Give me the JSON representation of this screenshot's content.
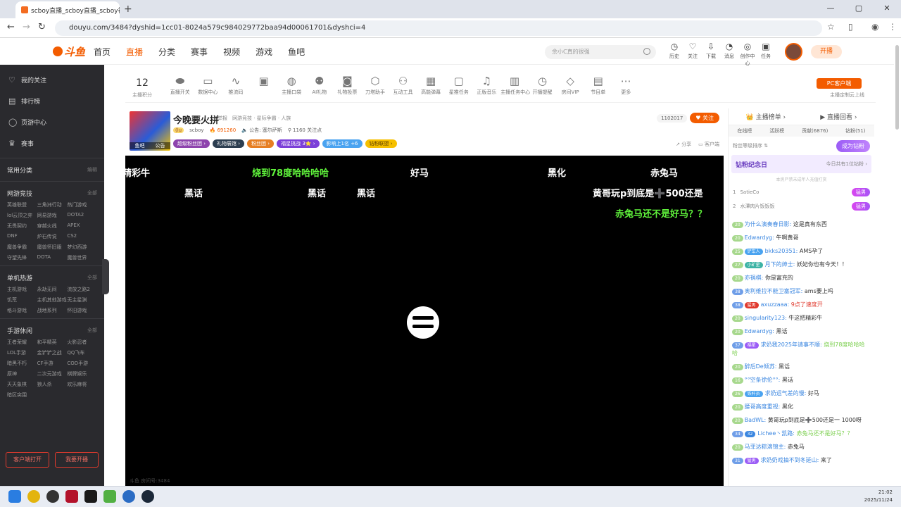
{
  "browser": {
    "tab_title": "scboy直播_scboy直播_scboy视",
    "tab_close": "✕",
    "new_tab": "+",
    "url": "douyu.com/3484?dyshid=1cc01-8024a579c984029772baa94d00061701&dyshci=4",
    "window_controls": [
      "—",
      "▢",
      "✕"
    ]
  },
  "topnav": {
    "logo": "斗鱼",
    "menu": [
      "首页",
      "直播",
      "分类",
      "赛事",
      "视频",
      "游戏",
      "鱼吧"
    ],
    "active_menu": "直播",
    "search_placeholder": "余小C真的很强",
    "tools": [
      {
        "icon": "history-icon",
        "glyph": "◷",
        "label": "历史"
      },
      {
        "icon": "heart-icon",
        "glyph": "♡",
        "label": "关注"
      },
      {
        "icon": "download-icon",
        "glyph": "⇩",
        "label": "下载"
      },
      {
        "icon": "bell-icon",
        "glyph": "◔",
        "label": "消息"
      },
      {
        "icon": "bulb-icon",
        "glyph": "◎",
        "label": "创作中心"
      },
      {
        "icon": "gift-icon",
        "glyph": "▣",
        "label": "任务"
      }
    ],
    "live_button": "开播"
  },
  "sidebar": {
    "top": [
      {
        "glyph": "♡",
        "label": "我的关注"
      },
      {
        "glyph": "▤",
        "label": "排行榜"
      },
      {
        "glyph": "◯",
        "label": "页游中心"
      },
      {
        "glyph": "♛",
        "label": "赛事"
      }
    ],
    "common": {
      "title": "常用分类",
      "more": "编辑"
    },
    "sections": [
      {
        "title": "网游竞技",
        "more": "全部",
        "items": [
          "英雄联盟",
          "三角洲行动",
          "热门游戏",
          "lol云顶之弈",
          "网易游戏",
          "DOTA2",
          "无畏契约",
          "穿越火线",
          "APEX",
          "DNF",
          "炉石传说",
          "CS2",
          "魔兽争霸",
          "魔兽怀旧服",
          "梦幻西游",
          "守望先锋",
          "DOTA",
          "魔兽世界"
        ]
      },
      {
        "title": "单机热游",
        "more": "全部",
        "items": [
          "主机游戏",
          "永劫无间",
          "流放之路2",
          "饥荒",
          "主机其他游戏",
          "无主星渊",
          "格斗游戏",
          "战地系列",
          "怀旧游戏"
        ]
      },
      {
        "title": "手游休闲",
        "more": "全部",
        "items": [
          "王者荣耀",
          "和平精英",
          "火影忍者",
          "LOL手游",
          "金铲铲之战",
          "QQ飞车",
          "暗黑不朽",
          "CF手游",
          "COD手游",
          "原神",
          "二次元游戏",
          "棋牌娱乐",
          "天天象棋",
          "狼人杀",
          "欢乐麻将",
          "暗区突围"
        ]
      }
    ],
    "btn_client": "客户端打开",
    "btn_live": "我要开播"
  },
  "toolbar": {
    "level": "12",
    "level_label": "主播积分",
    "items": [
      {
        "icon": "toggle-icon",
        "glyph": "⬬",
        "label": "直播开关"
      },
      {
        "icon": "monitor-icon",
        "glyph": "▭",
        "label": "数据中心"
      },
      {
        "icon": "wave-icon",
        "glyph": "∿",
        "label": "推流码"
      },
      {
        "icon": "gift-box-icon",
        "glyph": "▣",
        "label": " "
      },
      {
        "icon": "bag-icon",
        "glyph": "◍",
        "label": "主播口袋"
      },
      {
        "icon": "ai-icon",
        "glyph": "⚉",
        "label": "AI礼物"
      },
      {
        "icon": "cup-icon",
        "glyph": "◙",
        "label": "礼物投票"
      },
      {
        "icon": "shield-icon",
        "glyph": "⬡",
        "label": "刀塔助手"
      },
      {
        "icon": "people-icon",
        "glyph": "⚇",
        "label": "互动工具"
      },
      {
        "icon": "screen-icon",
        "glyph": "▦",
        "label": "高能弹幕"
      },
      {
        "icon": "ad-icon",
        "glyph": "▢",
        "label": "星推任务"
      },
      {
        "icon": "music-icon",
        "glyph": "♫",
        "label": "正版音乐"
      },
      {
        "icon": "clipboard-icon",
        "glyph": "▥",
        "label": "主播任务中心"
      },
      {
        "icon": "alarm-icon",
        "glyph": "◷",
        "label": "开播提醒"
      },
      {
        "icon": "diamond-icon",
        "glyph": "◇",
        "label": "房间VIP"
      },
      {
        "icon": "doc-icon",
        "glyph": "▤",
        "label": "节目单"
      },
      {
        "icon": "more-icon",
        "glyph": "⋯",
        "label": "更多"
      }
    ],
    "pc_client": "PC客户端",
    "pc_sub": "主播定制云上线"
  },
  "room": {
    "cover_left": "鱼吧",
    "cover_right": "公告",
    "title": "今晚要火拼",
    "tags": "举报　网游竞技 · 星际争霸 · 人族",
    "level": "(lu",
    "streamer": "scboy",
    "heat": "🔥 691260",
    "notice": "🔈 公告: 塞尔萨斯",
    "viewers": "⚲ 1160 关注点",
    "badges": [
      "超级粉丝团 ›",
      "礼物展馆 ›",
      "粉丝团 ›",
      "福星挑战 3⭐ ›",
      "影响上1名 +6",
      "钻粉联盟 ›"
    ],
    "badge_colors": [
      "#8e44ad",
      "#2c3e50",
      "#e67e22",
      "#7b3fd8",
      "#4aa3f0",
      "#f6c000"
    ],
    "follow_count": "1102017",
    "follow": "♥ 关注",
    "share": "↗ 分享",
    "client": "▭ 客户端"
  },
  "danmaku": [
    {
      "text": "精彩牛",
      "color": "white"
    },
    {
      "text": "烧到78度哈哈哈哈",
      "color": "green"
    },
    {
      "text": "好马",
      "color": "white"
    },
    {
      "text": "黑化",
      "color": "white"
    },
    {
      "text": "赤兔马",
      "color": "white"
    },
    {
      "text": "黑话",
      "color": "white"
    },
    {
      "text": "黑话",
      "color": "white"
    },
    {
      "text": "黑话",
      "color": "white"
    },
    {
      "text": "黄哥玩p到底是➕500还是",
      "color": "white"
    },
    {
      "text": "赤兔马还不是好马？？",
      "color": "green"
    }
  ],
  "video_footer": "斗鱼 房间号:3484",
  "rank": {
    "tab_rank": "👑 主播榜单 ›",
    "tab_replay": "▶ 直播回看 ›",
    "subtabs": [
      "在线榜",
      "活跃榜",
      "贡献(6876)",
      "钻粉(51)"
    ],
    "sort": "粉丝等级排序 ⇅",
    "become": "成为钻粉",
    "ann_title": "钻粉纪念日",
    "ann_sub": "今日共有1位钻粉 ›",
    "note": "本房严禁未成年人充值打赏",
    "rows": [
      {
        "rank": "1",
        "name": "SatieCo",
        "gift": "猛男"
      },
      {
        "rank": "2",
        "name": "水潭肉片饭饭饭",
        "gift": "猛男"
      }
    ]
  },
  "chat": [
    {
      "lv": "20",
      "fan": "",
      "fan_color": "",
      "nick": "为什么演奏春日影:",
      "text": "这是真有东西",
      "tc": ""
    },
    {
      "lv": "20",
      "fan": "",
      "fan_color": "",
      "nick": "Edwardyg:",
      "text": "牛啊黄哥",
      "tc": ""
    },
    {
      "lv": "25",
      "fan": "铲车人",
      "fan_color": "#4aa3f0",
      "nick": "bkks20351:",
      "text": "AMS孕了",
      "tc": ""
    },
    {
      "lv": "27",
      "fan": "小矿星",
      "fan_color": "#3cb3a5",
      "nick": "月下的绅士:",
      "text": "妖妃你也有今天！！",
      "tc": ""
    },
    {
      "lv": "20",
      "fan": "",
      "fan_color": "",
      "nick": "亦祸棋:",
      "text": "你是富充的",
      "tc": ""
    },
    {
      "lv": "38",
      "fan": "",
      "fan_color": "",
      "nick": "奥利维拉不能卫塞冠军:",
      "text": "ams要上吗",
      "tc": ""
    },
    {
      "lv": "38",
      "fan": "猛男",
      "fan_color": "#e0392d",
      "nick": "axuzzaaa:",
      "text": "9点了速度开",
      "tc": "red"
    },
    {
      "lv": "20",
      "fan": "",
      "fan_color": "",
      "nick": "singularity123:",
      "text": "牛这把精彩牛",
      "tc": ""
    },
    {
      "lv": "20",
      "fan": "",
      "fan_color": "",
      "nick": "Edwardyg:",
      "text": "黑话",
      "tc": ""
    },
    {
      "lv": "37",
      "fan": "福星",
      "fan_color": "#9b5cf6",
      "nick": "求奶我2025年请事不顺:",
      "text": "烧到78度哈哈哈哈",
      "tc": "green"
    },
    {
      "lv": "20",
      "fan": "",
      "fan_color": "",
      "nick": "醉后De倾苏:",
      "text": "黑话",
      "tc": ""
    },
    {
      "lv": "16",
      "fan": "",
      "fan_color": "",
      "nick": "°°空条徐伦°°:",
      "text": "黑话",
      "tc": ""
    },
    {
      "lv": "26",
      "fan": "铁杆员",
      "fan_color": "#4aa3f0",
      "nick": "求奶运气差的慢:",
      "text": "好马",
      "tc": ""
    },
    {
      "lv": "20",
      "fan": "",
      "fan_color": "",
      "nick": "腰哥高度重视:",
      "text": "黑化",
      "tc": ""
    },
    {
      "lv": "20",
      "fan": "",
      "fan_color": "",
      "nick": "BadWL:",
      "text": "黄哥玩p到底是➕500还是一 1000呀",
      "tc": ""
    },
    {
      "lv": "34",
      "fan": "32",
      "fan_color": "#3a86e0",
      "nick": "Lichee丶凯路:",
      "text": "赤兔马还不是好马？？",
      "tc": "green"
    },
    {
      "lv": "20",
      "fan": "",
      "fan_color": "",
      "nick": "马菲达粽滴锦主:",
      "text": "赤兔马",
      "tc": ""
    },
    {
      "lv": "31",
      "fan": "猛男",
      "fan_color": "#9b5cf6",
      "nick": "求奶奶戏抽不到冬延山:",
      "text": "来了",
      "tc": ""
    }
  ],
  "taskbar": {
    "time": "21:02",
    "date": "2025/11/24"
  }
}
